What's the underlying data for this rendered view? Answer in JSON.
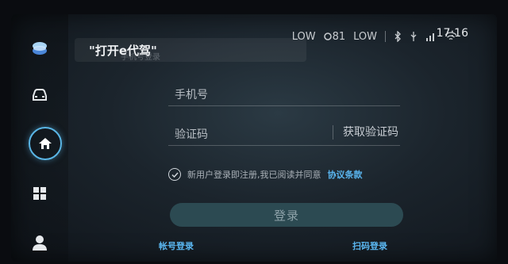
{
  "voice": {
    "command": "\"打开e代驾\"",
    "ghost": "手机号登录"
  },
  "status": {
    "temp_left": "LOW",
    "fan": "81",
    "temp_right": "LOW",
    "time": "17:16"
  },
  "sidebar": {
    "items": [
      {
        "icon": "assistant-ball-icon"
      },
      {
        "icon": "car-icon"
      },
      {
        "icon": "home-icon",
        "active": true
      },
      {
        "icon": "apps-grid-icon"
      },
      {
        "icon": "user-icon"
      }
    ]
  },
  "login": {
    "phone_placeholder": "手机号",
    "code_placeholder": "验证码",
    "get_code": "获取验证码",
    "agreement_text": "新用户登录即注册,我已阅读并同意",
    "agreement_link": "协议条款",
    "login_button": "登录",
    "account_login": "帐号登录",
    "scan_login": "扫码登录"
  },
  "colors": {
    "accent": "#5ab6f0",
    "button": "#2c4a52"
  }
}
